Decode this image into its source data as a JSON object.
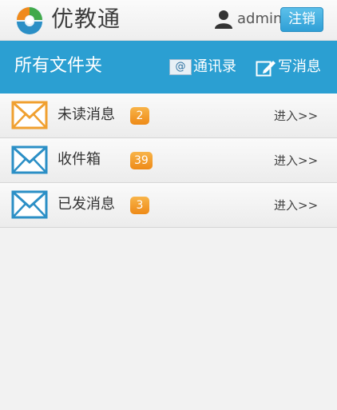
{
  "header": {
    "app_name": "优教通",
    "logo_icon": "app-logo-icon",
    "user_icon": "user-icon",
    "username": "admin",
    "logout_label": "注销"
  },
  "toolbar": {
    "title": "所有文件夹",
    "contacts_label": "通讯录",
    "contacts_icon_text": "@",
    "compose_label": "写消息"
  },
  "folders": [
    {
      "label": "未读消息",
      "count": "2",
      "enter": "进入>>",
      "icon": "envelope-icon",
      "icon_color": "#f0a030"
    },
    {
      "label": "收件箱",
      "count": "39",
      "enter": "进入>>",
      "icon": "envelope-icon",
      "icon_color": "#2b8fc6"
    },
    {
      "label": "已发消息",
      "count": "3",
      "enter": "进入>>",
      "icon": "envelope-icon",
      "icon_color": "#2b8fc6"
    }
  ],
  "colors": {
    "accent_blue": "#2b9fd2",
    "badge_orange": "#ee8a17",
    "logout_blue": "#3aa8dd"
  }
}
